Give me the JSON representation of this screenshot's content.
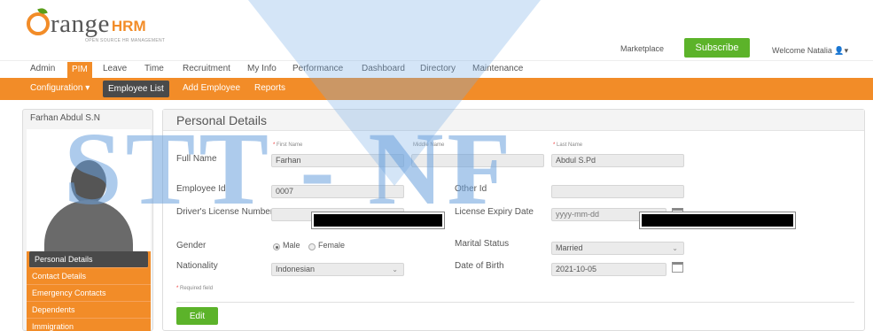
{
  "header": {
    "logo_text": "range",
    "logo_hrm": "HRM",
    "logo_tagline": "OPEN SOURCE HR MANAGEMENT",
    "marketplace": "Marketplace",
    "subscribe": "Subscribe",
    "welcome": "Welcome Natalia"
  },
  "mainnav": [
    "Admin",
    "PIM",
    "Leave",
    "Time",
    "Recruitment",
    "My Info",
    "Performance",
    "Dashboard",
    "Directory",
    "Maintenance"
  ],
  "subnav": [
    "Configuration",
    "Employee List",
    "Add Employee",
    "Reports"
  ],
  "employee_name": "Farhan Abdul S.N",
  "sidemenu": [
    "Personal Details",
    "Contact Details",
    "Emergency Contacts",
    "Dependents",
    "Immigration"
  ],
  "details": {
    "title": "Personal Details",
    "full_name_label": "Full Name",
    "first_name_label": "First Name",
    "middle_name_label": "Middle Name",
    "last_name_label": "Last Name",
    "first_name": "Farhan",
    "middle_name": "",
    "last_name": "Abdul S.Pd",
    "employee_id_label": "Employee Id",
    "employee_id": "0007",
    "other_id_label": "Other Id",
    "other_id": "",
    "license_label": "Driver's License Number",
    "license_value": "",
    "license_expiry_label": "License Expiry Date",
    "license_expiry_placeholder": "yyyy-mm-dd",
    "gender_label": "Gender",
    "gender_male": "Male",
    "gender_female": "Female",
    "marital_label": "Marital Status",
    "marital_value": "Married",
    "nationality_label": "Nationality",
    "nationality_value": "Indonesian",
    "dob_label": "Date of Birth",
    "dob_value": "2021-10-05",
    "required_note": "Required field",
    "edit": "Edit"
  },
  "watermark": "STT - NF",
  "colors": {
    "brand_orange": "#f28c28",
    "brand_green": "#5cb32a",
    "dark": "#4a4a4a"
  }
}
